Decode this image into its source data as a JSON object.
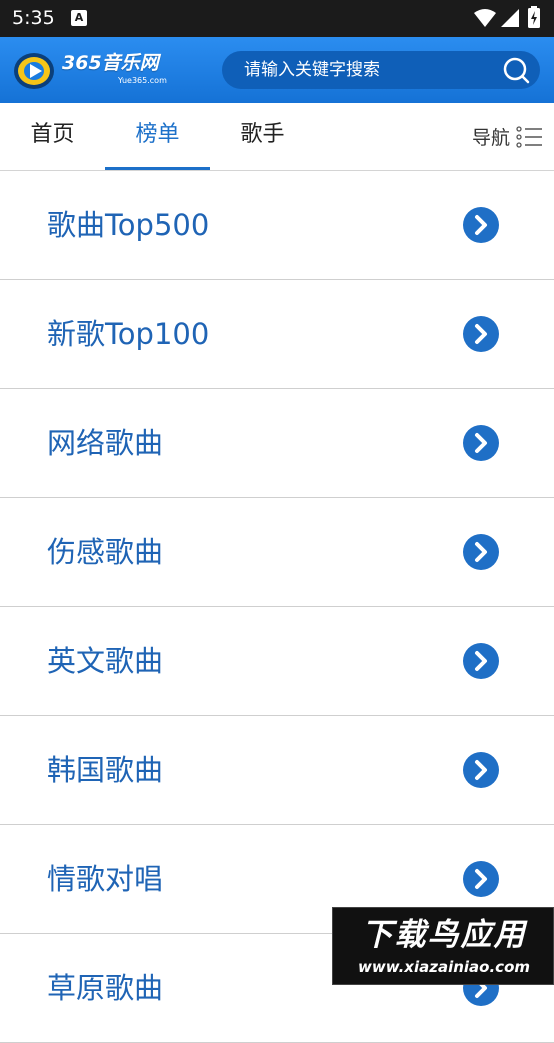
{
  "status_bar": {
    "time": "5:35",
    "notification_icon_letter": "A",
    "icons": [
      "wifi-icon",
      "signal-icon",
      "battery-icon"
    ]
  },
  "header": {
    "logo_text": "365音乐网",
    "logo_subtext": "Yue365.com",
    "search_placeholder": "请输入关键字搜索",
    "background_color": "#1a7ce0"
  },
  "nav": {
    "tabs": [
      {
        "label": "首页",
        "active": false
      },
      {
        "label": "榜单",
        "active": true
      },
      {
        "label": "歌手",
        "active": false
      }
    ],
    "menu_label": "导航",
    "accent_color": "#1c70c9"
  },
  "list": {
    "items": [
      {
        "label": "歌曲Top500"
      },
      {
        "label": "新歌Top100"
      },
      {
        "label": "网络歌曲"
      },
      {
        "label": "伤感歌曲"
      },
      {
        "label": "英文歌曲"
      },
      {
        "label": "韩国歌曲"
      },
      {
        "label": "情歌对唱"
      },
      {
        "label": "草原歌曲"
      }
    ],
    "text_color": "#1f64b5",
    "arrow_icon": "chevron-right-circle-icon"
  },
  "watermark": {
    "main": "下载鸟应用",
    "url": "www.xiazainiao.com"
  }
}
